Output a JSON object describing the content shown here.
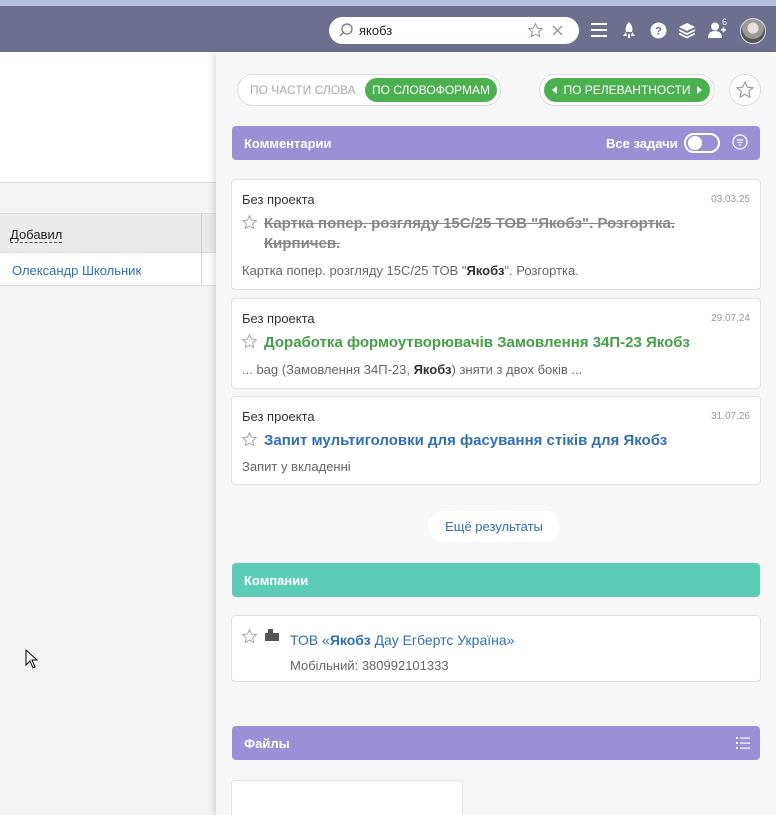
{
  "header": {
    "search_value": "якобз",
    "notification_count": "6",
    "icons": [
      "search-icon",
      "star-icon",
      "close-icon",
      "menu-icon",
      "rocket-icon",
      "help-icon",
      "layers-icon",
      "user-notify-icon",
      "avatar"
    ]
  },
  "background_page": {
    "column_header": "Добавил",
    "row_value": "Олександр Школьник"
  },
  "search_panel": {
    "mode_options": [
      "ПО ЧАСТИ СЛОВА",
      "ПО СЛОВОФОРМАМ"
    ],
    "mode_selected": "ПО СЛОВОФОРМАМ",
    "sort_label": "ПО РЕЛЕВАНТНОСТИ",
    "comments": {
      "title": "Комментарии",
      "toggle_label": "Все задачи",
      "results": [
        {
          "project": "Без проекта",
          "date": "03.03.25",
          "title": "Картка попер. розгляду 15С/25 ТОВ \"Якобз\". Розгортка. Кирпичев.",
          "status": "done",
          "snippet_before": "Картка попер. розгляду 15С/25 ТОВ \"",
          "snippet_bold": "Якобз",
          "snippet_after": "\". Розгортка."
        },
        {
          "project": "Без проекта",
          "date": "29.07.24",
          "title": "Доработка формоутворювачів Замовлення 34П-23 Якобз",
          "status": "active",
          "snippet_before": "... bag (Замовлення 34П-23, ",
          "snippet_bold": "Якобз",
          "snippet_after": ") зняти з двох боків ..."
        },
        {
          "project": "Без проекта",
          "date": "31.07.26",
          "title": "Запит мультиголовки для фасування стіків для Якобз",
          "status": "normal",
          "snippet_before": "Запит у вкладенні",
          "snippet_bold": "",
          "snippet_after": ""
        }
      ],
      "more_label": "Ещё результаты"
    },
    "companies": {
      "title": "Компании",
      "items": [
        {
          "name_before": "ТОВ «",
          "name_bold": "Якобз",
          "name_after": " Дау Егбертс Україна»",
          "phone": "Мобільний: 380992101333"
        }
      ]
    },
    "files": {
      "title": "Файлы"
    }
  },
  "colors": {
    "header_bg": "#6e6f8f",
    "purple_section": "#9b8fd6",
    "teal_section": "#5ccdb6",
    "green_accent": "#4caf50",
    "link_blue": "#2f6fb5"
  }
}
